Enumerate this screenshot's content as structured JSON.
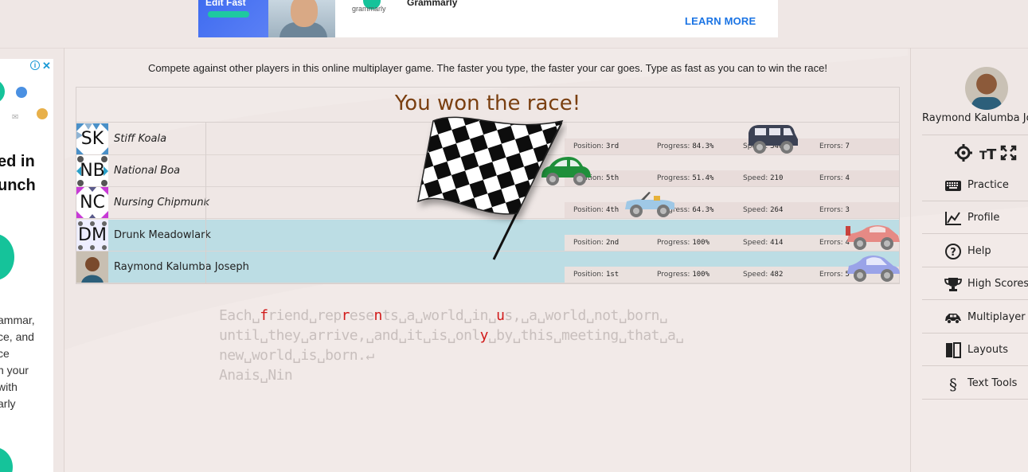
{
  "top_ad": {
    "left_title": "Edit Fast",
    "brand_small": "grammarly",
    "brand": "Grammarly",
    "cta": "LEARN MORE"
  },
  "side_ad": {
    "info": "i",
    "close": "✕",
    "headline": "ed in\nunch",
    "body": "ammar,\nce, and\nce\nn your\nwith\narly"
  },
  "intro": "Compete against other players in this online multiplayer game. The faster you type, the faster your car goes. Type as fast as you can to win the race!",
  "result": "You won the race!",
  "labels": {
    "position": "Position:",
    "progress": "Progress:",
    "speed": "Speed:",
    "errors": "Errors:"
  },
  "players": [
    {
      "initials": "SK",
      "name": "Stiff Koala",
      "position": "3rd",
      "progress": "84.3%",
      "speed": "340",
      "errors": "7",
      "car_color": "#3c4254",
      "car_type": "van"
    },
    {
      "initials": "NB",
      "name": "National Boa",
      "position": "5th",
      "progress": "51.4%",
      "speed": "210",
      "errors": "4",
      "car_color": "#1f8f3a",
      "car_type": "beetle"
    },
    {
      "initials": "NC",
      "name": "Nursing Chipmunk",
      "position": "4th",
      "progress": "64.3%",
      "speed": "264",
      "errors": "3",
      "car_color": "#9fc8e6",
      "car_type": "convertible"
    },
    {
      "initials": "DM",
      "name": "Drunk Meadowlark",
      "position": "2nd",
      "progress": "100%",
      "speed": "414",
      "errors": "4",
      "car_color": "#e68a85",
      "car_type": "sports"
    },
    {
      "initials": "",
      "name": "Raymond Kalumba Joseph",
      "position": "1st",
      "progress": "100%",
      "speed": "482",
      "errors": "5",
      "car_color": "#9aa3e8",
      "car_type": "sedan"
    }
  ],
  "text": {
    "line1": [
      {
        "t": "Each␣"
      },
      {
        "t": "f",
        "err": true
      },
      {
        "t": "riend␣rep"
      },
      {
        "t": "r",
        "err": true
      },
      {
        "t": "ese"
      },
      {
        "t": "n",
        "err": true
      },
      {
        "t": "ts␣a␣world␣in␣"
      },
      {
        "t": "u",
        "err": true
      },
      {
        "t": "s,␣a␣world␣not␣born␣"
      }
    ],
    "line2": [
      {
        "t": "until␣they␣arrive,␣and␣it␣is␣onl"
      },
      {
        "t": "y",
        "err": true
      },
      {
        "t": "␣by␣this␣meeting␣that␣a␣"
      }
    ],
    "line3": [
      {
        "t": "new␣world␣is␣born.↵"
      }
    ],
    "line4": [
      {
        "t": "Anais␣Nin"
      }
    ]
  },
  "user": {
    "name": "Raymond Kalumba Joseph"
  },
  "menu": [
    {
      "label": "Practice",
      "icon": "keyboard-icon"
    },
    {
      "label": "Profile",
      "icon": "chart-icon"
    },
    {
      "label": "Help",
      "icon": "help-icon"
    },
    {
      "label": "High Scores",
      "icon": "trophy-icon"
    },
    {
      "label": "Multiplayer",
      "icon": "car-icon"
    },
    {
      "label": "Layouts",
      "icon": "layouts-icon"
    },
    {
      "label": "Text Tools",
      "icon": "section-icon"
    }
  ],
  "colors": {
    "accent_text": "#7a3f10",
    "error": "#d11a1a",
    "you_lane": "#bcdde4",
    "cta": "#1b74e4"
  }
}
